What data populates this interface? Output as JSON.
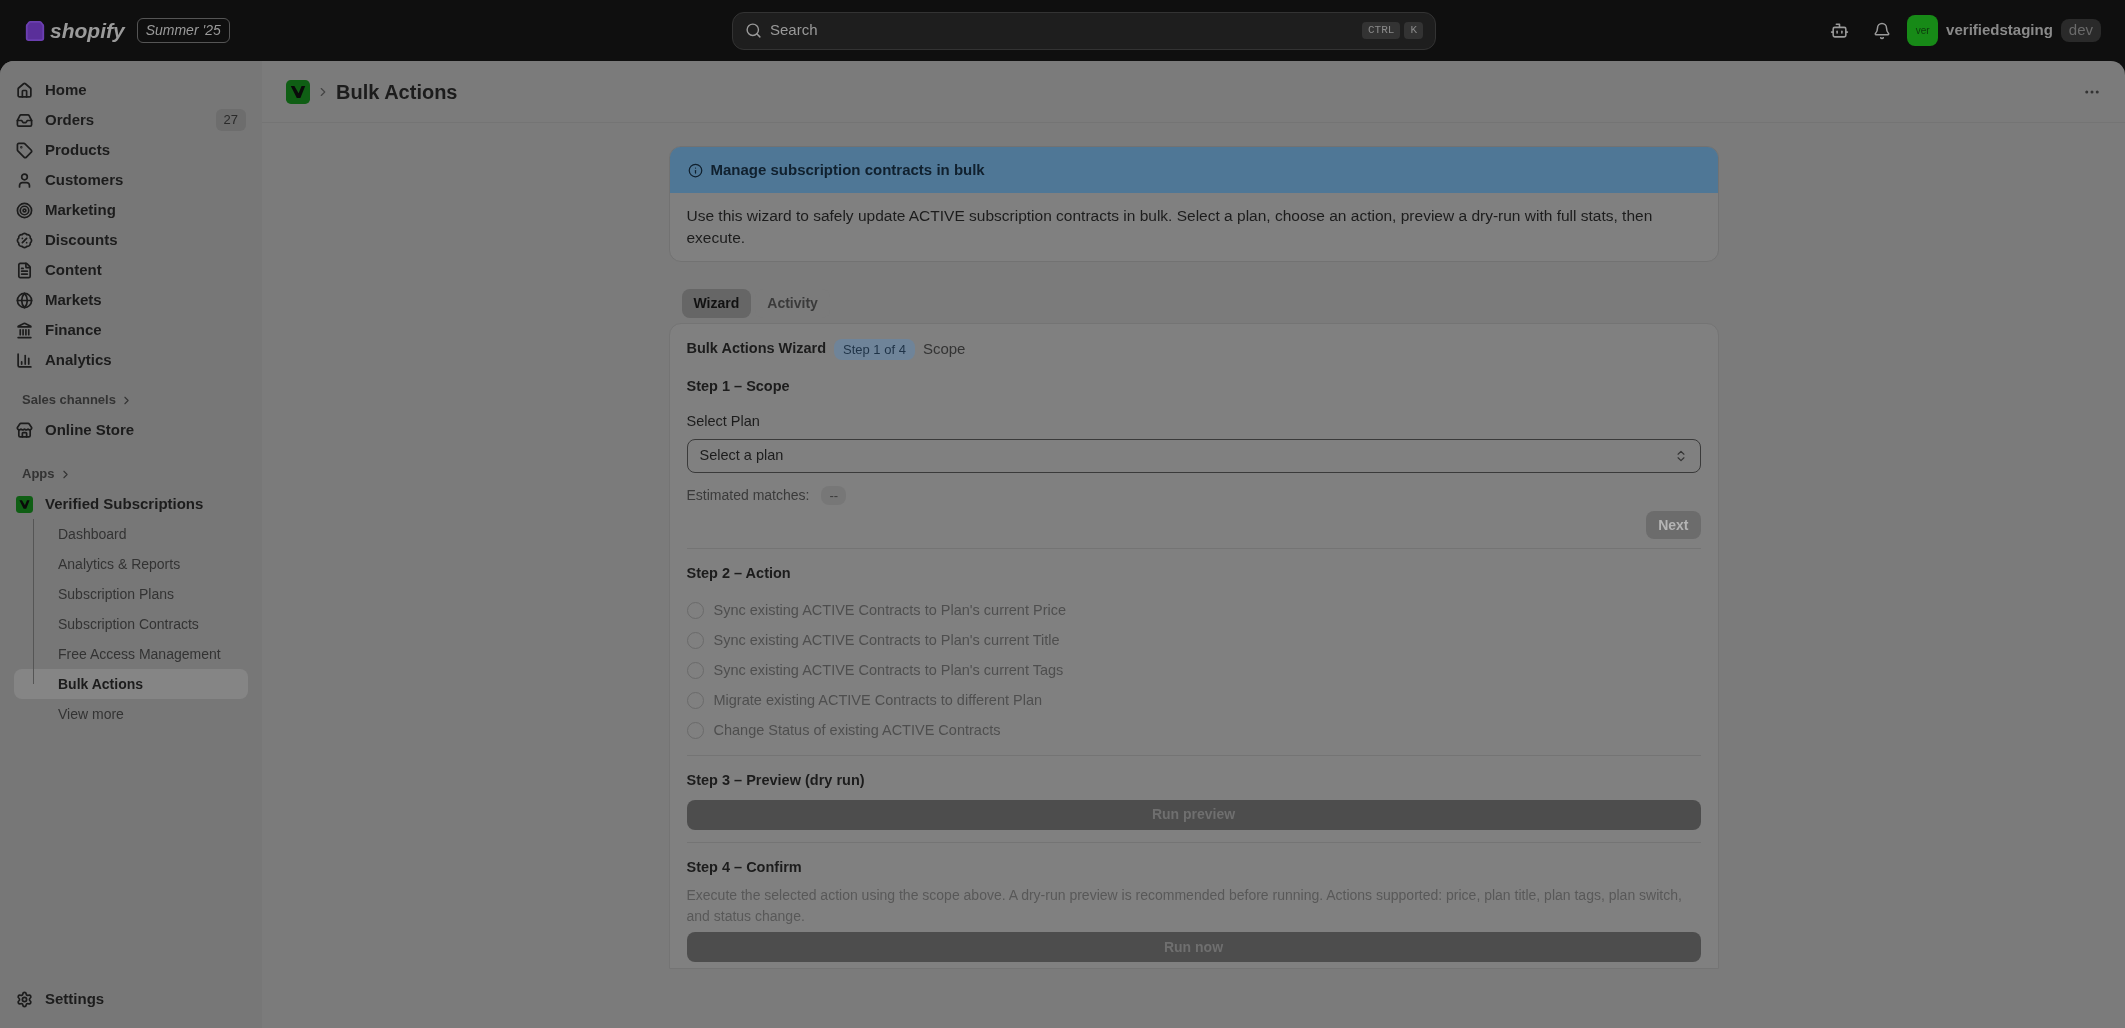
{
  "topbar": {
    "brand": "shopify",
    "edition": "Summer '25",
    "search": {
      "placeholder": "Search",
      "keys": [
        "CTRL",
        "K"
      ]
    },
    "store": {
      "avatar": "ver",
      "name": "verifiedstaging",
      "badge": "dev"
    }
  },
  "sidebar": {
    "items": [
      {
        "label": "Home",
        "selected": false
      },
      {
        "label": "Orders",
        "count": "27",
        "selected": false
      },
      {
        "label": "Products",
        "selected": false
      },
      {
        "label": "Customers",
        "selected": false
      },
      {
        "label": "Marketing",
        "selected": false
      },
      {
        "label": "Discounts",
        "selected": false
      },
      {
        "label": "Content",
        "selected": false
      },
      {
        "label": "Markets",
        "selected": false
      },
      {
        "label": "Finance",
        "selected": false
      },
      {
        "label": "Analytics",
        "selected": false
      }
    ],
    "sales_channels": {
      "heading": "Sales channels",
      "items": [
        {
          "label": "Online Store",
          "selected": false
        }
      ]
    },
    "apps": {
      "heading": "Apps",
      "app": {
        "label": "Verified Subscriptions",
        "children": [
          {
            "label": "Dashboard",
            "selected": false
          },
          {
            "label": "Analytics & Reports",
            "selected": false
          },
          {
            "label": "Subscription Plans",
            "selected": false
          },
          {
            "label": "Subscription Contracts",
            "selected": false
          },
          {
            "label": "Free Access Management",
            "selected": false
          },
          {
            "label": "Bulk Actions",
            "selected": true
          }
        ]
      },
      "more": "View more"
    },
    "settings": "Settings"
  },
  "page": {
    "breadcrumb": "Bulk Actions",
    "banner": {
      "title": "Manage subscription contracts in bulk",
      "body": "Use this wizard to safely update ACTIVE subscription contracts in bulk. Select a plan, choose an action, preview a dry-run with full stats, then execute."
    },
    "tabs": [
      {
        "label": "Wizard",
        "selected": true
      },
      {
        "label": "Activity",
        "selected": false
      }
    ],
    "wizard": {
      "title": "Bulk Actions Wizard",
      "step_badge": "Step 1 of 4",
      "step_name": "Scope",
      "step1": {
        "heading": "Step 1 – Scope",
        "field_label": "Select Plan",
        "select_value": "Select a plan",
        "matches_label": "Estimated matches:",
        "matches_value": "--",
        "next": {
          "label": "Next",
          "disabled": true
        }
      },
      "step2": {
        "heading": "Step 2 – Action",
        "options": [
          {
            "label": "Sync existing ACTIVE Contracts to Plan's current Price",
            "selected": false,
            "disabled": true
          },
          {
            "label": "Sync existing ACTIVE Contracts to Plan's current Title",
            "selected": false,
            "disabled": true
          },
          {
            "label": "Sync existing ACTIVE Contracts to Plan's current Tags",
            "selected": false,
            "disabled": true
          },
          {
            "label": "Migrate existing ACTIVE Contracts to different Plan",
            "selected": false,
            "disabled": true
          },
          {
            "label": "Change Status of existing ACTIVE Contracts",
            "selected": false,
            "disabled": true
          }
        ]
      },
      "step3": {
        "heading": "Step 3 – Preview (dry run)",
        "button": {
          "label": "Run preview",
          "disabled": true
        }
      },
      "step4": {
        "heading": "Step 4 – Confirm",
        "body": "Execute the selected action using the scope above. A dry-run preview is recommended before running. Actions supported: price, plan title, plan tags, plan switch, and status change.",
        "button": {
          "label": "Run now",
          "disabled": true
        }
      }
    }
  }
}
